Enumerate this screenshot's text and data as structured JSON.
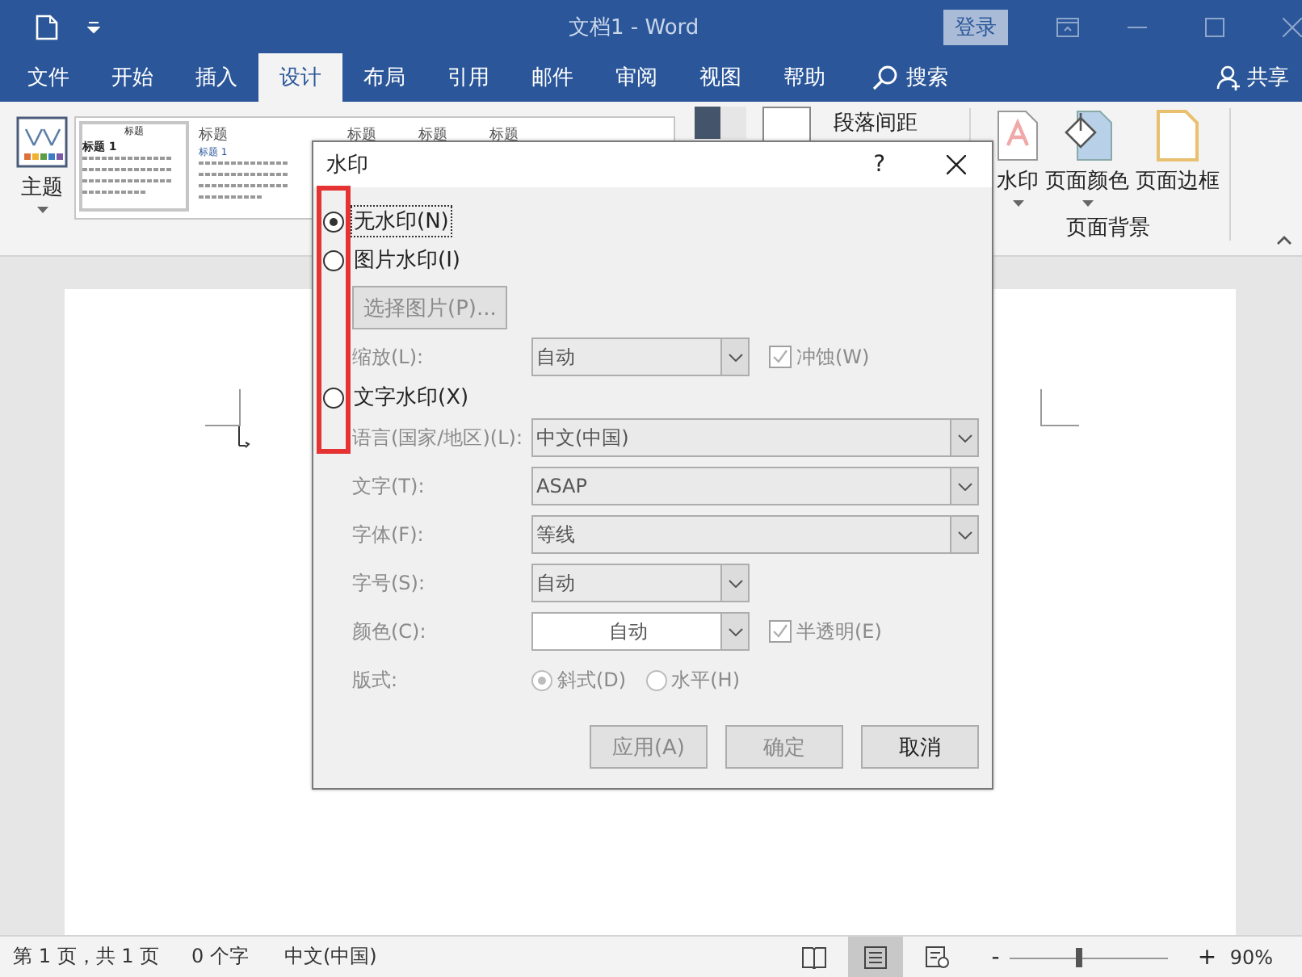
{
  "titlebar": {
    "title": "文档1  -  Word",
    "login": "登录"
  },
  "menu_tabs": [
    {
      "label": "文件",
      "selected": false
    },
    {
      "label": "开始",
      "selected": false
    },
    {
      "label": "插入",
      "selected": false
    },
    {
      "label": "设计",
      "selected": true
    },
    {
      "label": "布局",
      "selected": false
    },
    {
      "label": "引用",
      "selected": false
    },
    {
      "label": "邮件",
      "selected": false
    },
    {
      "label": "审阅",
      "selected": false
    },
    {
      "label": "视图",
      "selected": false
    },
    {
      "label": "帮助",
      "selected": false
    }
  ],
  "search": "搜索",
  "share": "共享",
  "ribbon": {
    "theme": "主题",
    "gallery": [
      {
        "title": "标题",
        "heading": "标题 1",
        "selected": true
      },
      {
        "title": "标题",
        "heading": "标题 1",
        "selected": false
      }
    ],
    "gallery_more": [
      "标题",
      "标题",
      "标题"
    ],
    "paragraph_spacing": "段落间距",
    "page_background": [
      "水印",
      "页面颜色",
      "页面边框"
    ],
    "group_label": "页面背景"
  },
  "dialog": {
    "title": "水印",
    "help": "?",
    "watermark_types": [
      {
        "label": "无水印(N)",
        "selected": true
      },
      {
        "label": "图片水印(I)",
        "selected": false
      },
      {
        "label": "文字水印(X)",
        "selected": false
      }
    ],
    "picture_button": {
      "label": "选择图片(P)...",
      "disabled": true
    },
    "scale": {
      "label": "缩放(L):",
      "value": "自动",
      "disabled": true
    },
    "washout": {
      "label": "冲蚀(W)",
      "checked": true,
      "disabled": true
    },
    "text_fields": [
      {
        "kind": "wide",
        "label": "语言(国家/地区)(L):",
        "value": "中文(中国)",
        "disabled": true
      },
      {
        "kind": "wide",
        "label": "文字(T):",
        "value": "ASAP",
        "disabled": true
      },
      {
        "kind": "wide",
        "label": "字体(F):",
        "value": "等线",
        "disabled": true
      },
      {
        "kind": "narrow",
        "label": "字号(S):",
        "value": "自动",
        "disabled": true
      },
      {
        "kind": "color",
        "label": "颜色(C):",
        "value": "自动",
        "disabled": true
      }
    ],
    "semitransparent": {
      "label": "半透明(E)",
      "checked": true,
      "disabled": true
    },
    "layout": {
      "label": "版式:",
      "options": [
        {
          "label": "斜式(D)",
          "selected": true
        },
        {
          "label": "水平(H)",
          "selected": false
        }
      ],
      "disabled": true
    },
    "buttons": [
      {
        "label": "应用(A)",
        "disabled": true
      },
      {
        "label": "确定",
        "disabled": true
      },
      {
        "label": "取消",
        "disabled": false
      }
    ]
  },
  "status_bar": {
    "page": "第 1 页，共 1 页",
    "words": "0 个字",
    "language": "中文(中国)",
    "views": [
      {
        "kind": "read",
        "selected": false
      },
      {
        "kind": "print",
        "selected": true
      },
      {
        "kind": "web",
        "selected": false
      }
    ],
    "zoom_out": "-",
    "zoom_in": "+",
    "zoom": {
      "level": 0.44
    },
    "zoom_text": "90%"
  }
}
